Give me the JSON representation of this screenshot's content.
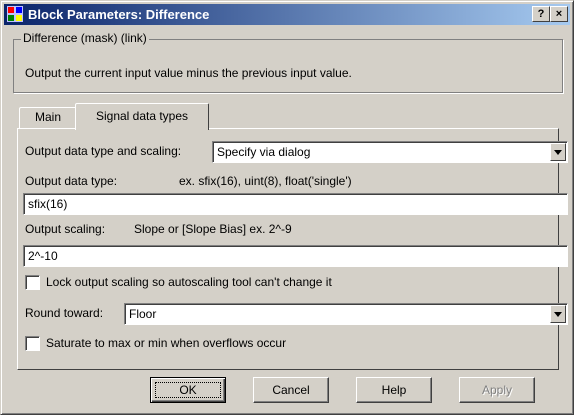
{
  "window": {
    "title": "Block Parameters: Difference",
    "help_glyph": "?",
    "close_glyph": "×",
    "icon": "simulink-block-icon"
  },
  "mask": {
    "group_title": "Difference (mask) (link)",
    "description": "Output the current input value minus the previous input value."
  },
  "tabs": [
    {
      "label": "Main",
      "selected": false
    },
    {
      "label": "Signal data types",
      "selected": true
    }
  ],
  "params": {
    "scaling_mode_label": "Output data type and scaling:",
    "scaling_mode_value": "Specify via dialog",
    "data_type_label": "Output data type:",
    "data_type_hint": "ex. sfix(16), uint(8), float('single')",
    "data_type_value": "sfix(16)",
    "scaling_label": "Output scaling:",
    "scaling_hint": "Slope or [Slope Bias]   ex. 2^-9",
    "scaling_value": "2^-10",
    "lock_label": "Lock output scaling so autoscaling tool can't change it",
    "lock_checked": false,
    "round_label": "Round toward:",
    "round_value": "Floor",
    "saturate_label": "Saturate to max or min when overflows occur",
    "saturate_checked": false
  },
  "buttons": {
    "ok": "OK",
    "cancel": "Cancel",
    "help": "Help",
    "apply": "Apply"
  },
  "colors": {
    "title_start": "#0a246a",
    "title_end": "#a6caf0",
    "face": "#d4d0c8"
  }
}
